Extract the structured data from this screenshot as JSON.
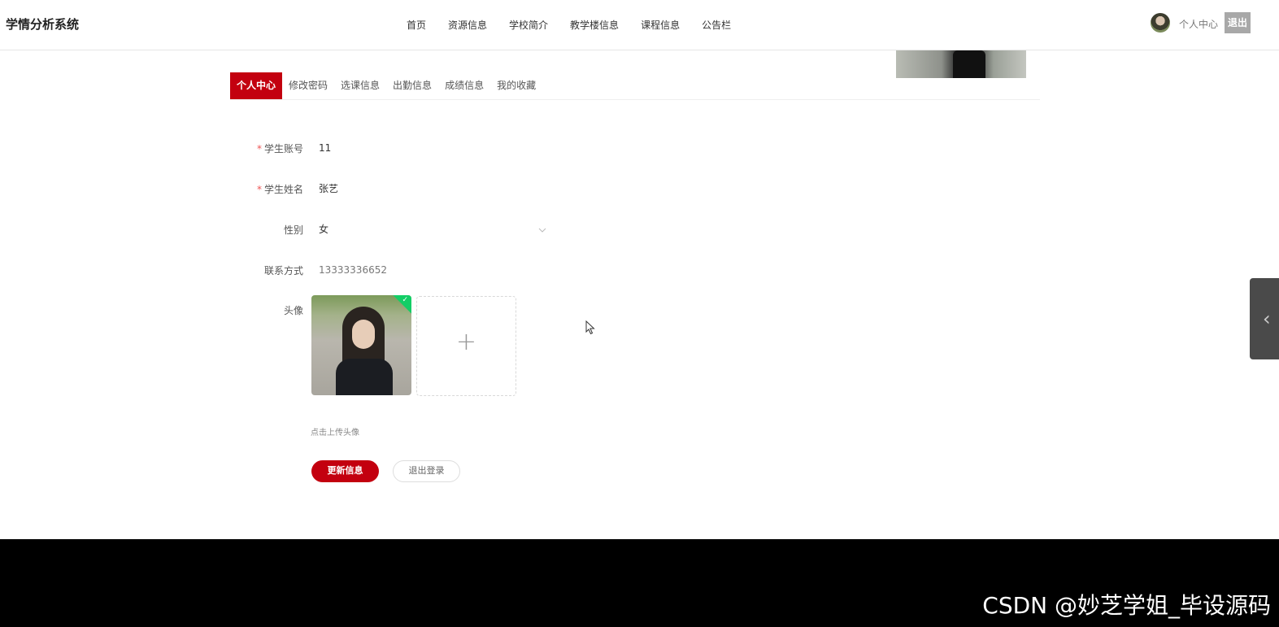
{
  "header": {
    "brand": "学情分析系统",
    "nav": [
      "首页",
      "资源信息",
      "学校简介",
      "教学楼信息",
      "课程信息",
      "公告栏"
    ],
    "user_center": "个人中心",
    "logout": "退出"
  },
  "tabs": [
    "个人中心",
    "修改密码",
    "选课信息",
    "出勤信息",
    "成绩信息",
    "我的收藏"
  ],
  "form": {
    "account_label": "学生账号",
    "account_value": "11",
    "name_label": "学生姓名",
    "name_value": "张艺",
    "gender_label": "性别",
    "gender_value": "女",
    "phone_label": "联系方式",
    "phone_value": "13333336652",
    "avatar_label": "头像",
    "upload_hint": "点击上传头像",
    "required_mark": "*"
  },
  "buttons": {
    "update": "更新信息",
    "logout": "退出登录"
  },
  "footer": {
    "watermark": "CSDN @妙芝学姐_毕设源码"
  },
  "colors": {
    "accent": "#c3000f",
    "success": "#13ce66"
  }
}
